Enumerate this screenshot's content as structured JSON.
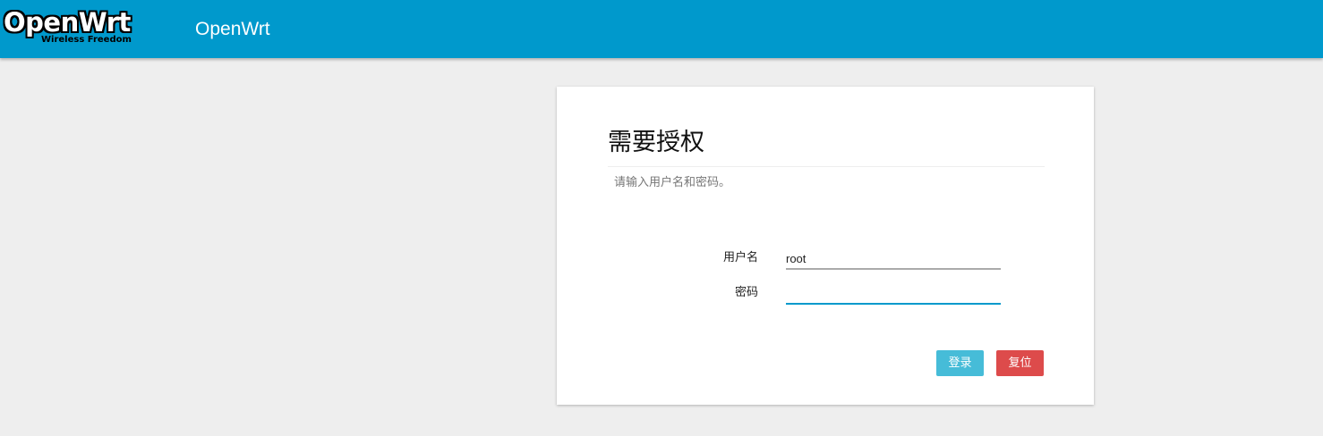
{
  "header": {
    "logo_text": "OpenWrt",
    "logo_tagline": "Wireless Freedom",
    "brand_title": "OpenWrt"
  },
  "login": {
    "title": "需要授权",
    "description": "请输入用户名和密码。",
    "username_label": "用户名",
    "username_value": "root",
    "password_label": "密码",
    "password_value": "",
    "login_button": "登录",
    "reset_button": "复位"
  },
  "colors": {
    "header_bg": "#0099cc",
    "page_bg": "#eeeeee",
    "login_button": "#46bcd8",
    "reset_button": "#dd4b4b",
    "input_focus": "#0099cc"
  }
}
